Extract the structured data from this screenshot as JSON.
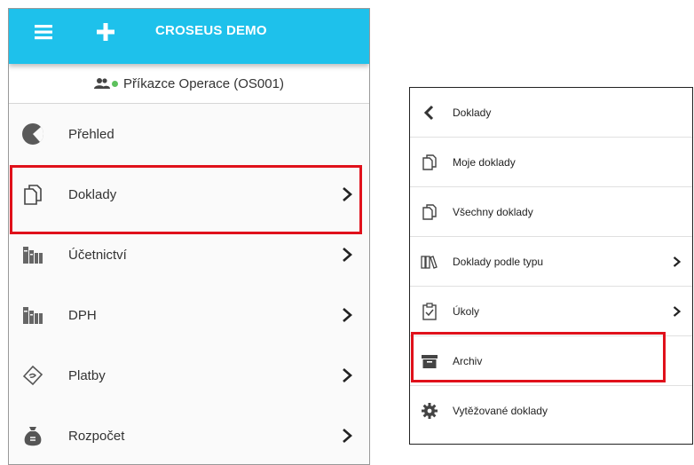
{
  "left_panel": {
    "app_title": "CROSEUS DEMO",
    "user": {
      "name": "Příkazce Operace (OS001)",
      "status_color": "#5dc15d"
    },
    "menu": [
      {
        "label": "Přehled",
        "icon": "pie-chart-icon",
        "has_submenu": false
      },
      {
        "label": "Doklady",
        "icon": "documents-icon",
        "has_submenu": true
      },
      {
        "label": "Účetnictví",
        "icon": "books-icon",
        "has_submenu": true
      },
      {
        "label": "DPH",
        "icon": "books-icon",
        "has_submenu": true
      },
      {
        "label": "Platby",
        "icon": "payment-icon",
        "has_submenu": true
      },
      {
        "label": "Rozpočet",
        "icon": "money-bag-icon",
        "has_submenu": true
      }
    ],
    "highlighted_item": "Doklady"
  },
  "right_panel": {
    "back_label": "Doklady",
    "menu": [
      {
        "label": "Moje doklady",
        "icon": "documents-icon",
        "has_submenu": false
      },
      {
        "label": "Všechny doklady",
        "icon": "documents-icon",
        "has_submenu": false
      },
      {
        "label": "Doklady podle typu",
        "icon": "books-icon",
        "has_submenu": true
      },
      {
        "label": "Úkoly",
        "icon": "clipboard-check-icon",
        "has_submenu": true
      },
      {
        "label": "Archiv",
        "icon": "archive-box-icon",
        "has_submenu": false
      },
      {
        "label": "Vytěžované doklady",
        "icon": "gear-icon",
        "has_submenu": false
      }
    ],
    "highlighted_item": "Archiv"
  },
  "colors": {
    "topbar": "#1ec1eb",
    "highlight": "#e0111b",
    "icon": "#555555"
  }
}
